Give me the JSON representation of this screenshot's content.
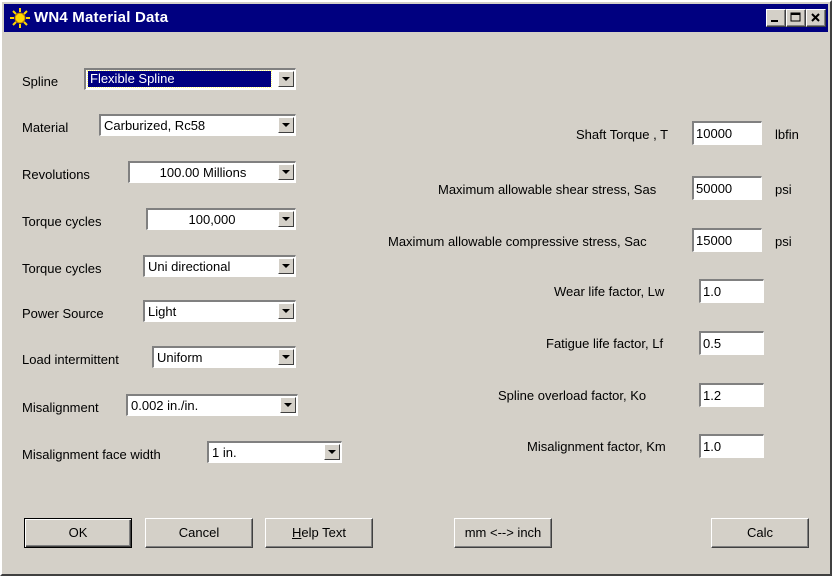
{
  "window": {
    "title": "WN4 Material Data"
  },
  "left": {
    "spline": {
      "label": "Spline",
      "value": "Flexible Spline"
    },
    "material": {
      "label": "Material",
      "value": "Carburized, Rc58"
    },
    "revolutions": {
      "label": "Revolutions",
      "value": "100.00 Millions"
    },
    "torque_cycles": {
      "label": "Torque cycles",
      "value": "100,000"
    },
    "torque_direction": {
      "label": "Torque cycles",
      "value": "Uni directional"
    },
    "power_source": {
      "label": "Power Source",
      "value": "Light"
    },
    "load_intermittent": {
      "label": "Load intermittent",
      "value": "Uniform"
    },
    "misalignment": {
      "label": "Misalignment",
      "value": "0.002 in./in."
    },
    "misalignment_face_width": {
      "label": "Misalignment face width",
      "value": "1 in."
    }
  },
  "right": {
    "shaft_torque": {
      "label": "Shaft Torque , T",
      "value": "10000",
      "unit": "lbfin"
    },
    "max_shear": {
      "label": "Maximum allowable shear stress, Sas",
      "value": "50000",
      "unit": "psi"
    },
    "max_compressive": {
      "label": "Maximum allowable compressive stress, Sac",
      "value": "15000",
      "unit": "psi"
    },
    "wear_life": {
      "label": "Wear life factor, Lw",
      "value": "1.0"
    },
    "fatigue_life": {
      "label": "Fatigue life factor, Lf",
      "value": "0.5"
    },
    "overload": {
      "label": "Spline overload factor, Ko",
      "value": "1.2"
    },
    "misalignment_factor": {
      "label": "Misalignment factor, Km",
      "value": "1.0"
    }
  },
  "buttons": {
    "ok": "OK",
    "cancel": "Cancel",
    "help_prefix": "H",
    "help_rest": "elp Text",
    "units": "mm <--> inch",
    "calc": "Calc"
  },
  "icons": {
    "app_icon": "sun-icon",
    "minimize": "minimize-icon",
    "maximize": "maximize-icon",
    "close": "close-icon",
    "dropdown": "chevron-down-icon"
  },
  "colors": {
    "titlebar": "#000080",
    "face": "#d4d0c8",
    "selection": "#000080"
  }
}
